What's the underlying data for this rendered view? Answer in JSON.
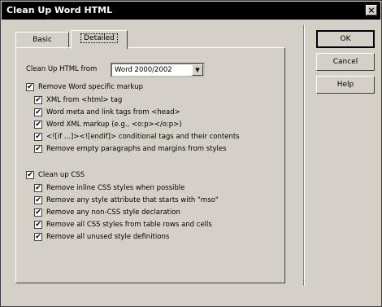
{
  "window": {
    "title": "Clean Up Word HTML",
    "close_glyph": "×"
  },
  "tabs": [
    {
      "label": "Basic"
    },
    {
      "label": "Detailed"
    }
  ],
  "clean_from": {
    "label": "Clean Up HTML from",
    "selected": "Word 2000/2002",
    "arrow": "▼"
  },
  "word_group": {
    "label": "Remove Word specific markup",
    "checked": true,
    "items": [
      {
        "label": "XML from <html> tag",
        "checked": true
      },
      {
        "label": "Word meta and link tags from <head>",
        "checked": true
      },
      {
        "label": "Word XML markup (e.g., <o:p></o:p>)",
        "checked": true
      },
      {
        "label": "<![if ...]><![endif]> conditional tags and their contents",
        "checked": true
      },
      {
        "label": "Remove empty paragraphs and margins from styles",
        "checked": true
      }
    ]
  },
  "css_group": {
    "label": "Clean up CSS",
    "checked": true,
    "items": [
      {
        "label": "Remove inline CSS styles when possible",
        "checked": true
      },
      {
        "label": "Remove any style attribute that starts with \"mso\"",
        "checked": true
      },
      {
        "label": "Remove any non-CSS style declaration",
        "checked": true
      },
      {
        "label": "Remove all CSS styles from table rows and cells",
        "checked": true
      },
      {
        "label": "Remove all unused style definitions",
        "checked": true
      }
    ]
  },
  "buttons": {
    "ok": "OK",
    "cancel": "Cancel",
    "help": "Help"
  },
  "check_glyph": "✔"
}
